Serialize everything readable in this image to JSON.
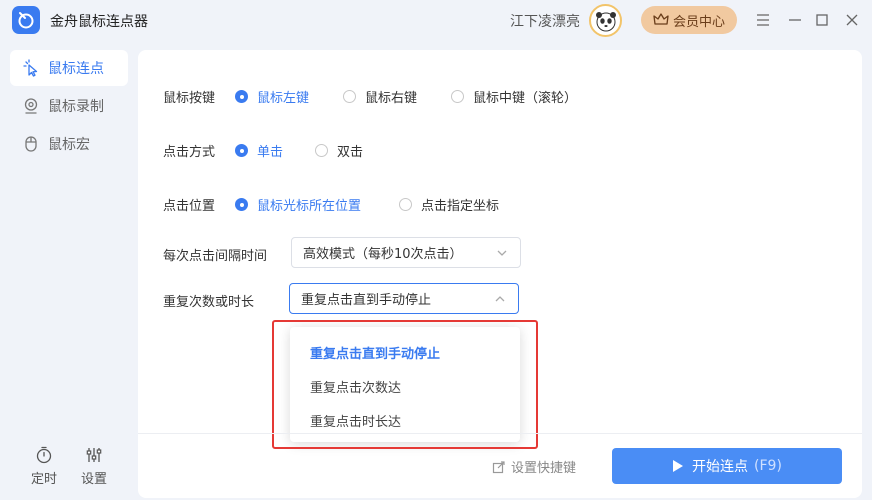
{
  "app": {
    "title": "金舟鼠标连点器"
  },
  "user": {
    "name": "江下凌漂亮",
    "vip_label": "会员中心"
  },
  "sidebar": {
    "items": [
      {
        "label": "鼠标连点",
        "active": true
      },
      {
        "label": "鼠标录制",
        "active": false
      },
      {
        "label": "鼠标宏",
        "active": false
      }
    ],
    "tools": [
      {
        "label": "定时"
      },
      {
        "label": "设置"
      }
    ]
  },
  "form": {
    "mouse_button": {
      "label": "鼠标按键",
      "options": [
        "鼠标左键",
        "鼠标右键",
        "鼠标中键（滚轮）"
      ],
      "selected": "鼠标左键"
    },
    "click_mode": {
      "label": "点击方式",
      "options": [
        "单击",
        "双击"
      ],
      "selected": "单击"
    },
    "click_position": {
      "label": "点击位置",
      "options": [
        "鼠标光标所在位置",
        "点击指定坐标"
      ],
      "selected": "鼠标光标所在位置"
    },
    "interval": {
      "label": "每次点击间隔时间",
      "value": "高效模式（每秒10次点击）"
    },
    "repeat": {
      "label": "重复次数或时长",
      "value": "重复点击直到手动停止",
      "options": [
        "重复点击直到手动停止",
        "重复点击次数达",
        "重复点击时长达"
      ]
    }
  },
  "footer": {
    "shortcut_label": "设置快捷键",
    "start_label": "开始连点",
    "start_hotkey": "(F9)"
  },
  "colors": {
    "accent": "#3a7bf0",
    "button": "#4a8df5",
    "vip": "#f1c9a0",
    "highlight": "#e53935"
  }
}
